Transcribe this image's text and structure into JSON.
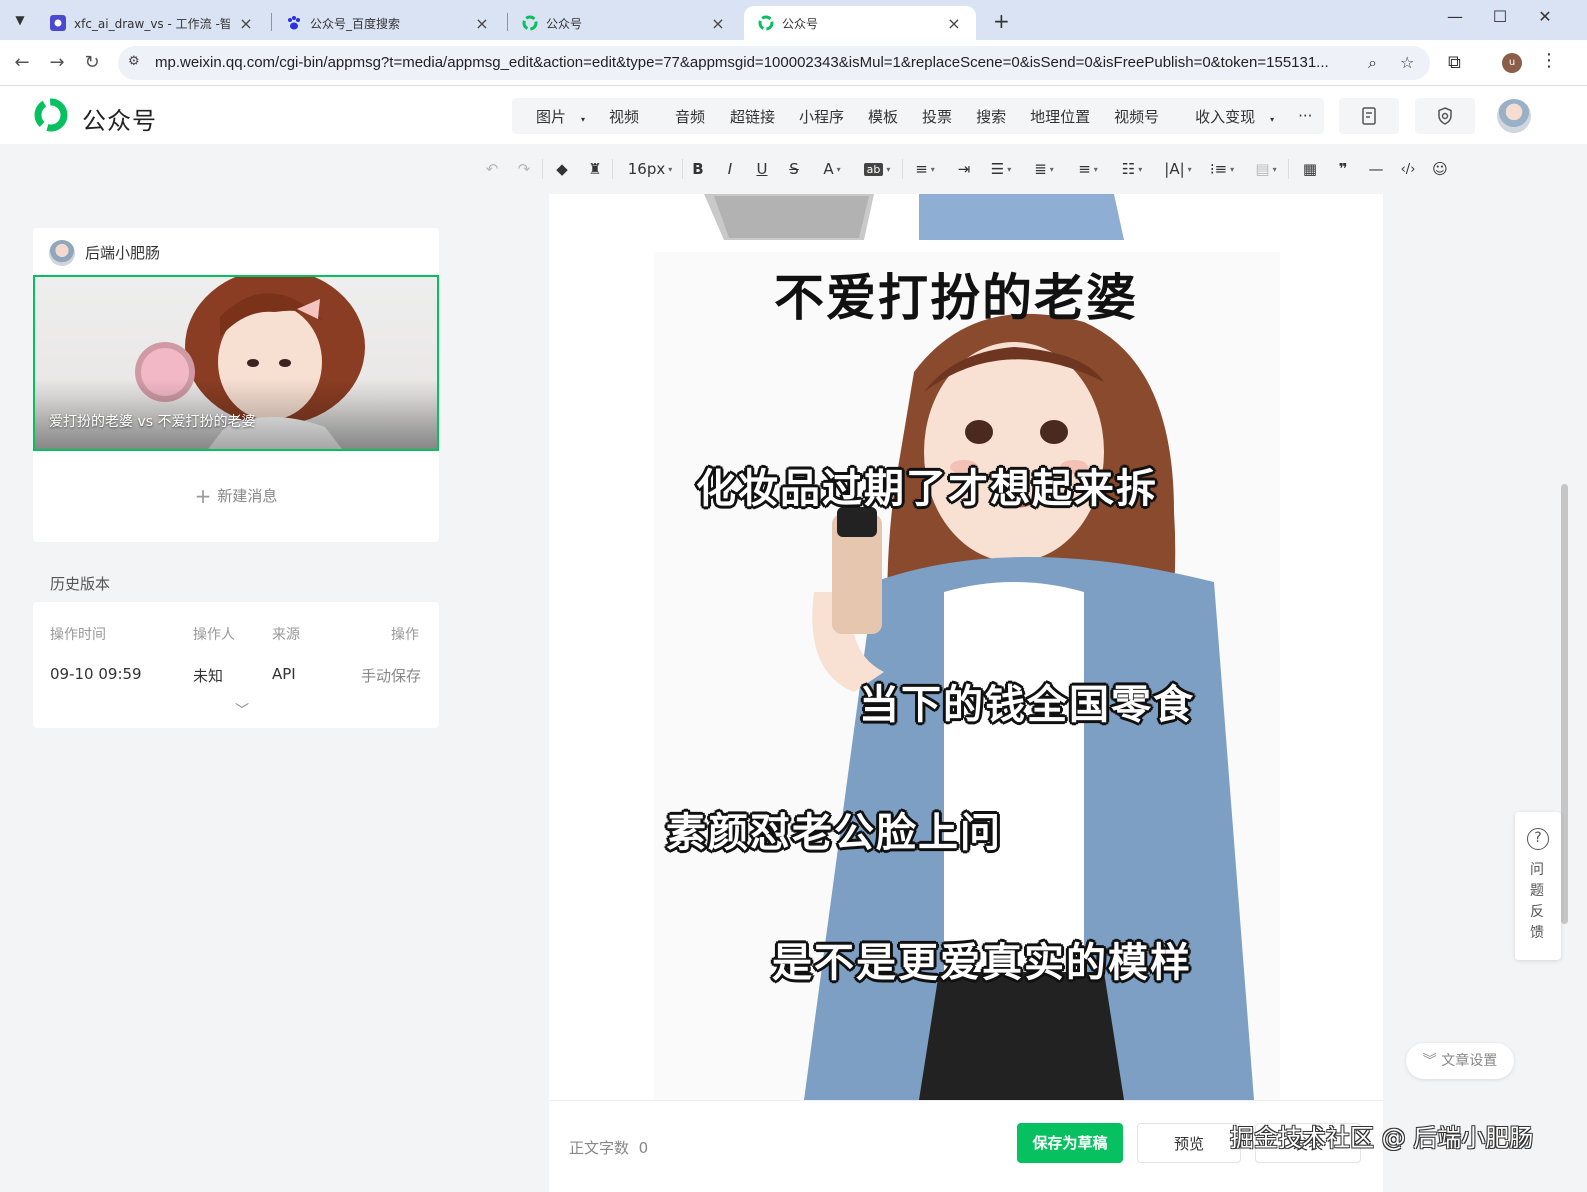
{
  "browser": {
    "tabs": [
      {
        "title": "xfc_ai_draw_vs - 工作流 -智能..."
      },
      {
        "title": "公众号_百度搜索"
      },
      {
        "title": "公众号"
      },
      {
        "title": "公众号"
      }
    ],
    "url": "mp.weixin.qq.com/cgi-bin/appmsg?t=media/appmsg_edit&action=edit&type=77&appmsgid=100002343&isMul=1&replaceScene=0&isSend=0&isFreePublish=0&token=155131...",
    "profile_initial": "u"
  },
  "app": {
    "brand": "公众号",
    "insert_group_1": [
      "图片",
      "视频",
      "音频"
    ],
    "insert_group_2": [
      "超链接",
      "小程序",
      "模板",
      "投票",
      "搜索",
      "地理位置",
      "视频号",
      "收入变现"
    ],
    "more": "···"
  },
  "toolbar": {
    "font_size": "16px"
  },
  "left_panel": {
    "account_name": "后端小肥肠",
    "cover_title": "爱打扮的老婆 vs 不爱打扮的老婆",
    "new_message": "新建消息",
    "history_label": "历史版本",
    "history_headers": [
      "操作时间",
      "操作人",
      "来源",
      "操作"
    ],
    "history_rows": [
      {
        "time": "09-10 09:59",
        "operator": "未知",
        "source": "API",
        "action": "手动保存"
      }
    ]
  },
  "editor": {
    "image_title": "不爱打扮的老婆",
    "captions": [
      "化妆品过期了才想起来拆",
      "当下的钱全国零食",
      "素颜怼老公脸上问",
      "是不是更爱真实的模样"
    ]
  },
  "bottom": {
    "word_count_label": "正文字数",
    "word_count": "0",
    "save_draft": "保存为草稿",
    "preview": "预览",
    "publish": "发表"
  },
  "side": {
    "feedback": "问题反馈",
    "article_settings": "文章设置"
  },
  "watermark": "掘金技术社区 @ 后端小肥肠",
  "colors": {
    "accent_green": "#07c160",
    "tabbar": "#d9e3f3"
  }
}
